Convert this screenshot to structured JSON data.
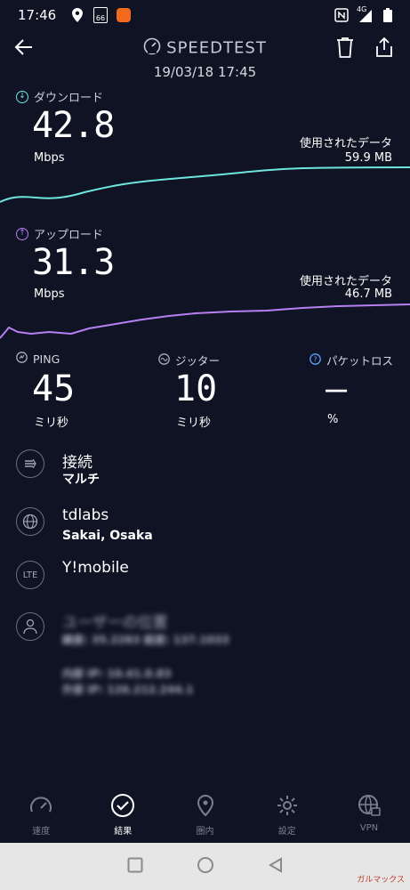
{
  "status_bar": {
    "time": "17:46",
    "calendar_badge": "66",
    "network": "4G"
  },
  "header": {
    "title": "SPEEDTEST",
    "timestamp": "19/03/18 17:45"
  },
  "download": {
    "label": "ダウンロード",
    "value": "42.8",
    "unit": "Mbps",
    "data_used_label": "使用されたデータ",
    "data_used_value": "59.9 MB",
    "color": "#6ee6e0"
  },
  "upload": {
    "label": "アップロード",
    "value": "31.3",
    "unit": "Mbps",
    "data_used_label": "使用されたデータ",
    "data_used_value": "46.7 MB",
    "color": "#b77ff2"
  },
  "ping": {
    "label": "PING",
    "value": "45",
    "unit": "ミリ秒"
  },
  "jitter": {
    "label": "ジッター",
    "value": "10",
    "unit": "ミリ秒"
  },
  "packet_loss": {
    "label": "パケットロス",
    "value": "–",
    "unit": "%"
  },
  "connection": {
    "title": "接続",
    "value": "マルチ"
  },
  "server": {
    "name": "tdlabs",
    "location": "Sakai, Osaka"
  },
  "provider": {
    "icon_text": "LTE",
    "name": "Y!mobile"
  },
  "user_location": {
    "title": "ユーザーの位置",
    "coords": "緯度: 35.2283 経度: 137.1033",
    "internal_ip": "内部 IP: 10.41.0.83",
    "external_ip": "外部 IP: 126.212.244.1"
  },
  "nav": {
    "speed": "速度",
    "results": "結果",
    "coverage": "圏内",
    "settings": "設定",
    "vpn": "VPN"
  },
  "watermark": "ガルマックス"
}
